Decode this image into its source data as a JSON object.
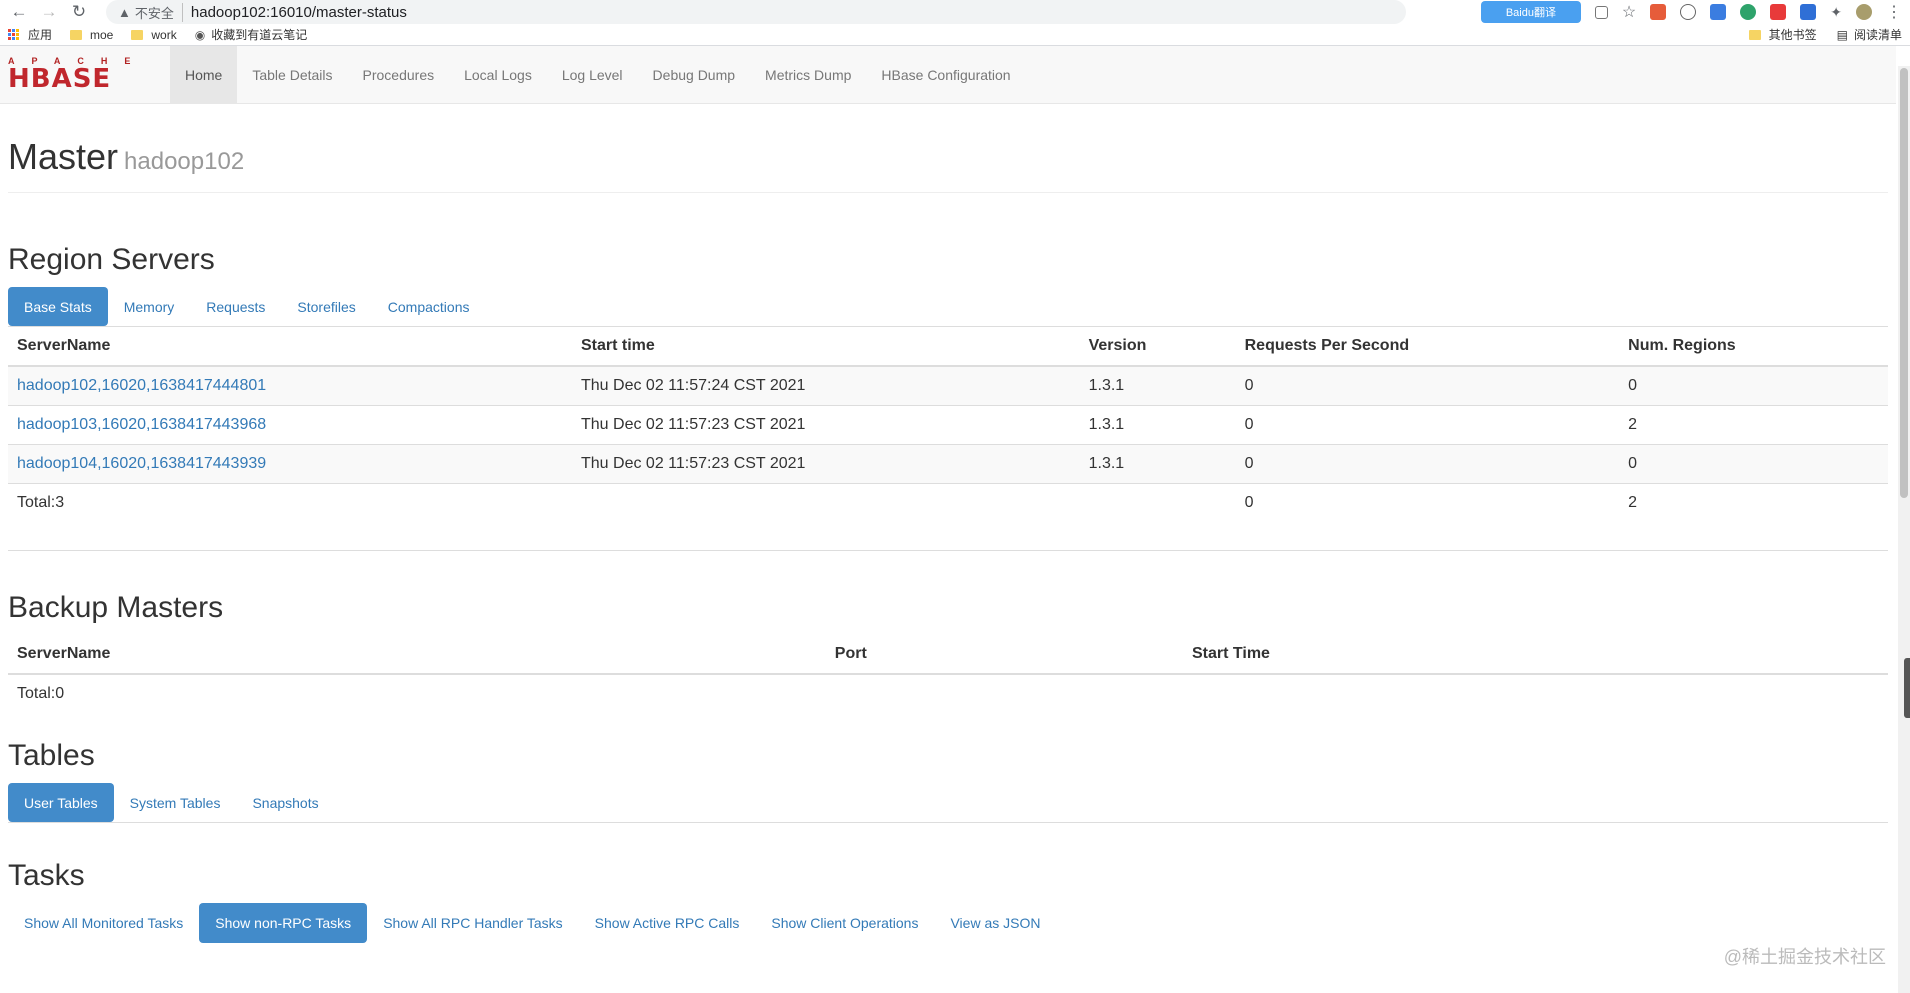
{
  "browser": {
    "insecure_label": "不安全",
    "url": "hadoop102:16010/master-status",
    "extension_label": "Baidu翻译",
    "bookmarks": [
      "应用",
      "moe",
      "work",
      "收藏到有道云笔记"
    ],
    "bookmarks_right": [
      "其他书签",
      "阅读清单"
    ]
  },
  "navbar": {
    "logo_top": "APACHE",
    "logo_main": "HBASE",
    "items": [
      "Home",
      "Table Details",
      "Procedures",
      "Local Logs",
      "Log Level",
      "Debug Dump",
      "Metrics Dump",
      "HBase Configuration"
    ]
  },
  "header": {
    "title": "Master",
    "subtitle": "hadoop102"
  },
  "region_servers": {
    "title": "Region Servers",
    "tabs": [
      "Base Stats",
      "Memory",
      "Requests",
      "Storefiles",
      "Compactions"
    ],
    "columns": [
      "ServerName",
      "Start time",
      "Version",
      "Requests Per Second",
      "Num. Regions"
    ],
    "rows": [
      [
        "hadoop102,16020,1638417444801",
        "Thu Dec 02 11:57:24 CST 2021",
        "1.3.1",
        "0",
        "0"
      ],
      [
        "hadoop103,16020,1638417443968",
        "Thu Dec 02 11:57:23 CST 2021",
        "1.3.1",
        "0",
        "2"
      ],
      [
        "hadoop104,16020,1638417443939",
        "Thu Dec 02 11:57:23 CST 2021",
        "1.3.1",
        "0",
        "0"
      ]
    ],
    "total": {
      "label": "Total:3",
      "requests": "0",
      "regions": "2"
    }
  },
  "backup_masters": {
    "title": "Backup Masters",
    "columns": [
      "ServerName",
      "Port",
      "Start Time"
    ],
    "total": "Total:0"
  },
  "tables": {
    "title": "Tables",
    "tabs": [
      "User Tables",
      "System Tables",
      "Snapshots"
    ]
  },
  "tasks": {
    "title": "Tasks",
    "tabs": [
      "Show All Monitored Tasks",
      "Show non-RPC Tasks",
      "Show All RPC Handler Tasks",
      "Show Active RPC Calls",
      "Show Client Operations",
      "View as JSON"
    ]
  },
  "watermark": "@稀土掘金技术社区"
}
